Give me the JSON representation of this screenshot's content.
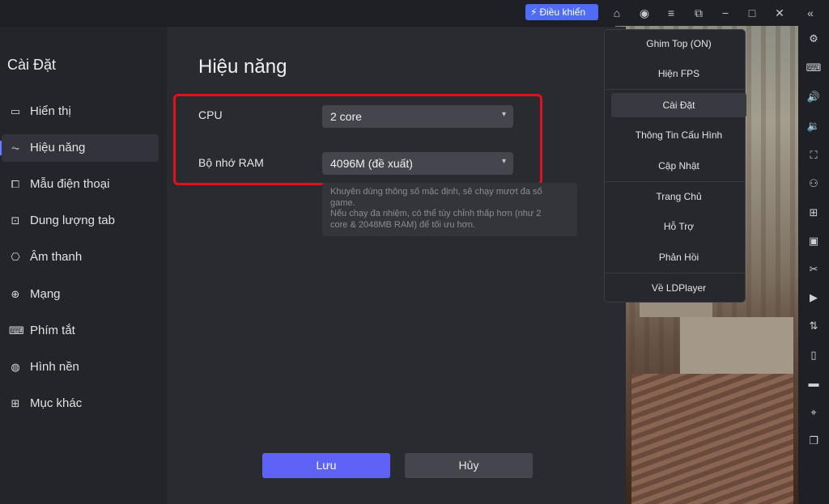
{
  "topbar": {
    "control_label": "Điều khiển",
    "icons": [
      "lightning-icon",
      "gift-icon",
      "account-icon",
      "menu-icon",
      "screen-rotate-icon",
      "minimize-icon",
      "maximize-icon",
      "close-icon",
      "collapse-icon"
    ]
  },
  "sidebar": {
    "title": "Cài Đặt",
    "items": [
      {
        "label": "Hiển thị",
        "icon": "monitor-icon"
      },
      {
        "label": "Hiệu năng",
        "icon": "performance-icon"
      },
      {
        "label": "Mẫu điện thoại",
        "icon": "phone-model-icon"
      },
      {
        "label": "Dung lượng tab",
        "icon": "storage-icon"
      },
      {
        "label": "Âm thanh",
        "icon": "gamepad-icon"
      },
      {
        "label": "Mạng",
        "icon": "globe-icon"
      },
      {
        "label": "Phím tắt",
        "icon": "keyboard-icon"
      },
      {
        "label": "Hình nền",
        "icon": "palette-icon"
      },
      {
        "label": "Mục khác",
        "icon": "grid-icon"
      }
    ]
  },
  "main": {
    "title": "Hiệu năng",
    "cpu_label": "CPU",
    "cpu_value": "2 core",
    "ram_label": "Bộ nhớ RAM",
    "ram_value": "4096M (đề xuất)",
    "hint_line1": "Khuyên dùng thông số mặc định, sẽ chạy mượt đa số",
    "hint_line2": "game.",
    "hint_line3": "Nếu chạy đa nhiệm, có thể tùy chỉnh thấp hơn (như 2",
    "hint_line4": "core & 2048MB RAM) để tối ưu hơn.",
    "save_label": "Lưu",
    "cancel_label": "Hủy"
  },
  "menu": {
    "items": [
      "Ghim Top (ON)",
      "Hiện FPS",
      "Cài Đặt",
      "Thông Tin Cấu Hình",
      "Cập Nhật",
      "Trang Chủ",
      "Hỗ Trợ",
      "Phản Hồi",
      "Về LDPlayer"
    ],
    "active_index": 2
  },
  "colors": {
    "accent": "#5e62f6",
    "control_button": "#4e6cf6",
    "highlight": "#e0101e"
  }
}
